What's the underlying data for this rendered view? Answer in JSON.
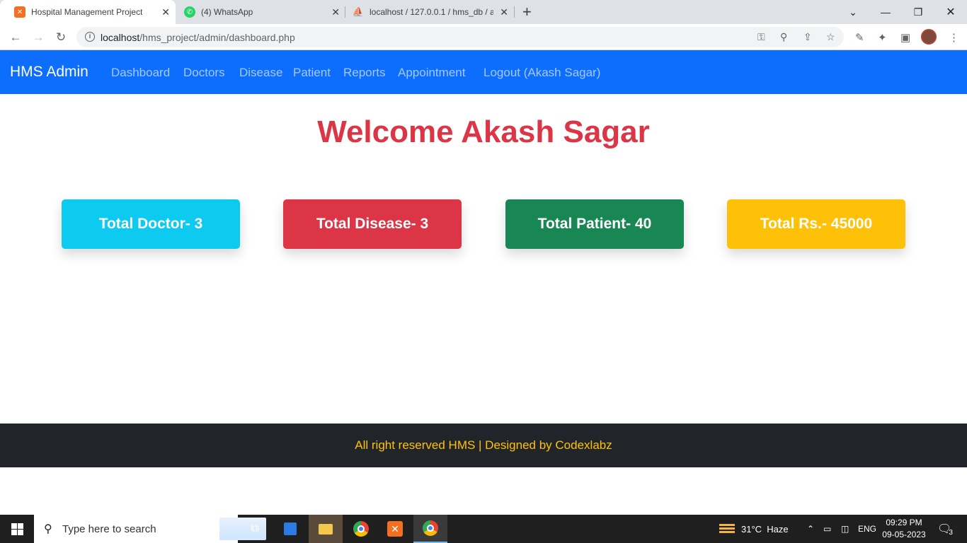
{
  "browser": {
    "tabs": [
      {
        "title": "Hospital Management Project",
        "icon": "xampp-icon",
        "active": true
      },
      {
        "title": "(4) WhatsApp",
        "icon": "whatsapp-icon",
        "active": false
      },
      {
        "title": "localhost / 127.0.0.1 / hms_db / a",
        "icon": "phpmyadmin-icon",
        "active": false
      }
    ],
    "url_host": "localhost",
    "url_path": "/hms_project/admin/dashboard.php"
  },
  "navbar": {
    "brand": "HMS Admin",
    "links": [
      "Dashboard",
      "Doctors",
      "Disease",
      "Patient",
      "Reports",
      "Appointment",
      "Logout (Akash Sagar)"
    ],
    "color": "#0d6efd"
  },
  "welcome": "Welcome Akash Sagar",
  "cards": [
    {
      "label": "Total Doctor- 3",
      "color": "#0dcaf0"
    },
    {
      "label": "Total Disease- 3",
      "color": "#dc3545"
    },
    {
      "label": "Total Patient- 40",
      "color": "#198754"
    },
    {
      "label": "Total Rs.- 45000",
      "color": "#ffc107"
    }
  ],
  "footer": {
    "text": "All right reserved HMS | Designed by Codexlabz",
    "color": "#ffc107"
  },
  "taskbar": {
    "search_placeholder": "Type here to search",
    "weather": "31°C  Haze",
    "language": "ENG",
    "time": "09:29 PM",
    "date": "09-05-2023",
    "notifications": "3"
  }
}
